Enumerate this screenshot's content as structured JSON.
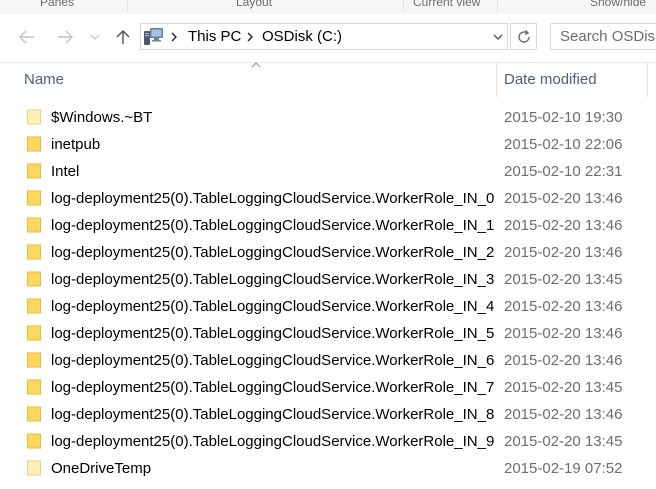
{
  "ribbon": {
    "groups": [
      "Panes",
      "Layout",
      "Current view",
      "Show/hide"
    ]
  },
  "address": {
    "segments": [
      "This PC",
      "OSDisk (C:)"
    ]
  },
  "search": {
    "placeholder": "Search OSDisk"
  },
  "columns": {
    "name": "Name",
    "date": "Date modified"
  },
  "files": [
    {
      "name": "$Windows.~BT",
      "date": "2015-02-10 19:30",
      "hidden": true
    },
    {
      "name": "inetpub",
      "date": "2015-02-10 22:06",
      "hidden": false
    },
    {
      "name": "Intel",
      "date": "2015-02-10 22:31",
      "hidden": false
    },
    {
      "name": "log-deployment25(0).TableLoggingCloudService.WorkerRole_IN_0",
      "date": "2015-02-20 13:46",
      "hidden": false
    },
    {
      "name": "log-deployment25(0).TableLoggingCloudService.WorkerRole_IN_1",
      "date": "2015-02-20 13:46",
      "hidden": false
    },
    {
      "name": "log-deployment25(0).TableLoggingCloudService.WorkerRole_IN_2",
      "date": "2015-02-20 13:46",
      "hidden": false
    },
    {
      "name": "log-deployment25(0).TableLoggingCloudService.WorkerRole_IN_3",
      "date": "2015-02-20 13:45",
      "hidden": false
    },
    {
      "name": "log-deployment25(0).TableLoggingCloudService.WorkerRole_IN_4",
      "date": "2015-02-20 13:46",
      "hidden": false
    },
    {
      "name": "log-deployment25(0).TableLoggingCloudService.WorkerRole_IN_5",
      "date": "2015-02-20 13:46",
      "hidden": false
    },
    {
      "name": "log-deployment25(0).TableLoggingCloudService.WorkerRole_IN_6",
      "date": "2015-02-20 13:46",
      "hidden": false
    },
    {
      "name": "log-deployment25(0).TableLoggingCloudService.WorkerRole_IN_7",
      "date": "2015-02-20 13:45",
      "hidden": false
    },
    {
      "name": "log-deployment25(0).TableLoggingCloudService.WorkerRole_IN_8",
      "date": "2015-02-20 13:46",
      "hidden": false
    },
    {
      "name": "log-deployment25(0).TableLoggingCloudService.WorkerRole_IN_9",
      "date": "2015-02-20 13:45",
      "hidden": false
    },
    {
      "name": "OneDriveTemp",
      "date": "2015-02-19 07:52",
      "hidden": true
    }
  ],
  "colors": {
    "folder": "#ffd75e",
    "folder_hidden": "#fff0b8",
    "header_text": "#4c607a",
    "date_text": "#6d6d6d"
  },
  "icons": {
    "back": "arrow-left-icon",
    "forward": "arrow-right-icon",
    "recent": "chevron-down-icon",
    "up": "arrow-up-icon",
    "location": "computer-icon",
    "refresh": "refresh-icon",
    "folder": "folder-icon"
  }
}
